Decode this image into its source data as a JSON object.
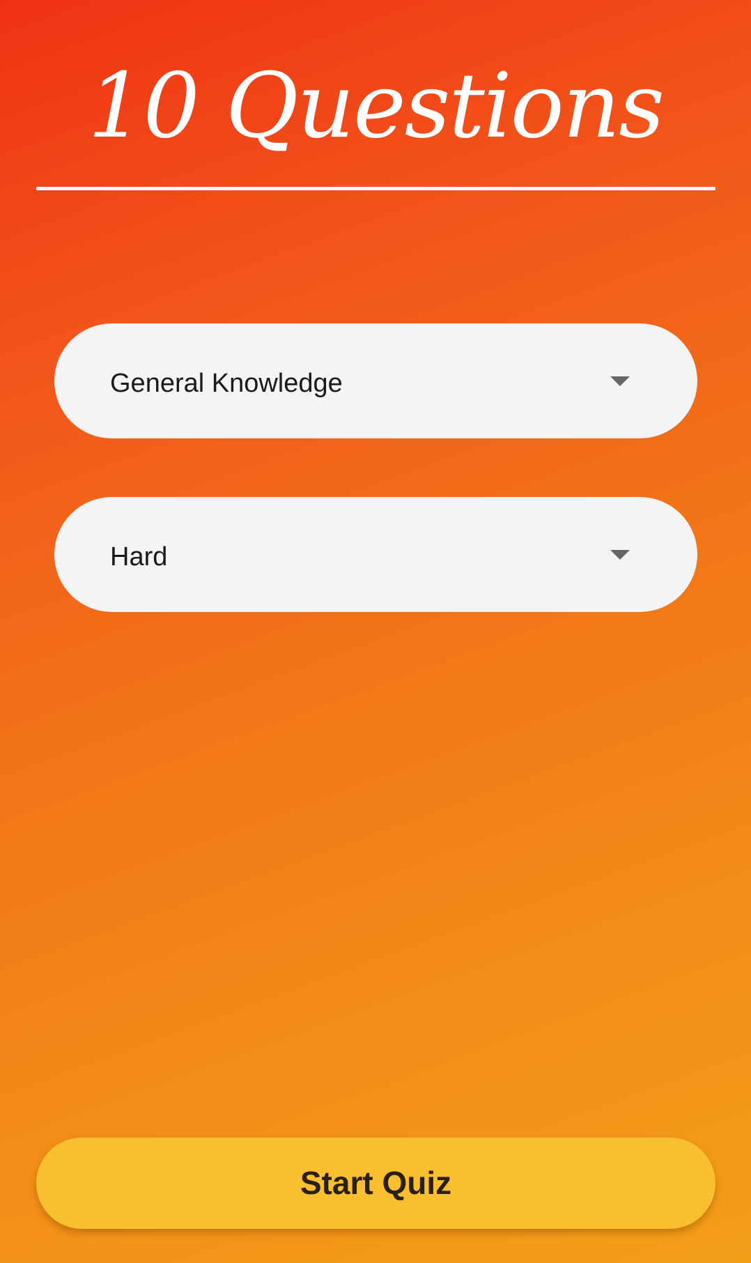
{
  "header": {
    "title": "10 Questions"
  },
  "form": {
    "category": {
      "selected": "General Knowledge"
    },
    "difficulty": {
      "selected": "Hard"
    }
  },
  "actions": {
    "start_label": "Start Quiz"
  },
  "icons": {
    "dropdown": "chevron-down-icon"
  },
  "colors": {
    "gradient_start": "#f03214",
    "gradient_end": "#f39f18",
    "field_background": "#f4f4f4",
    "button_background": "#f9bf2e",
    "button_text": "#2b2015"
  }
}
